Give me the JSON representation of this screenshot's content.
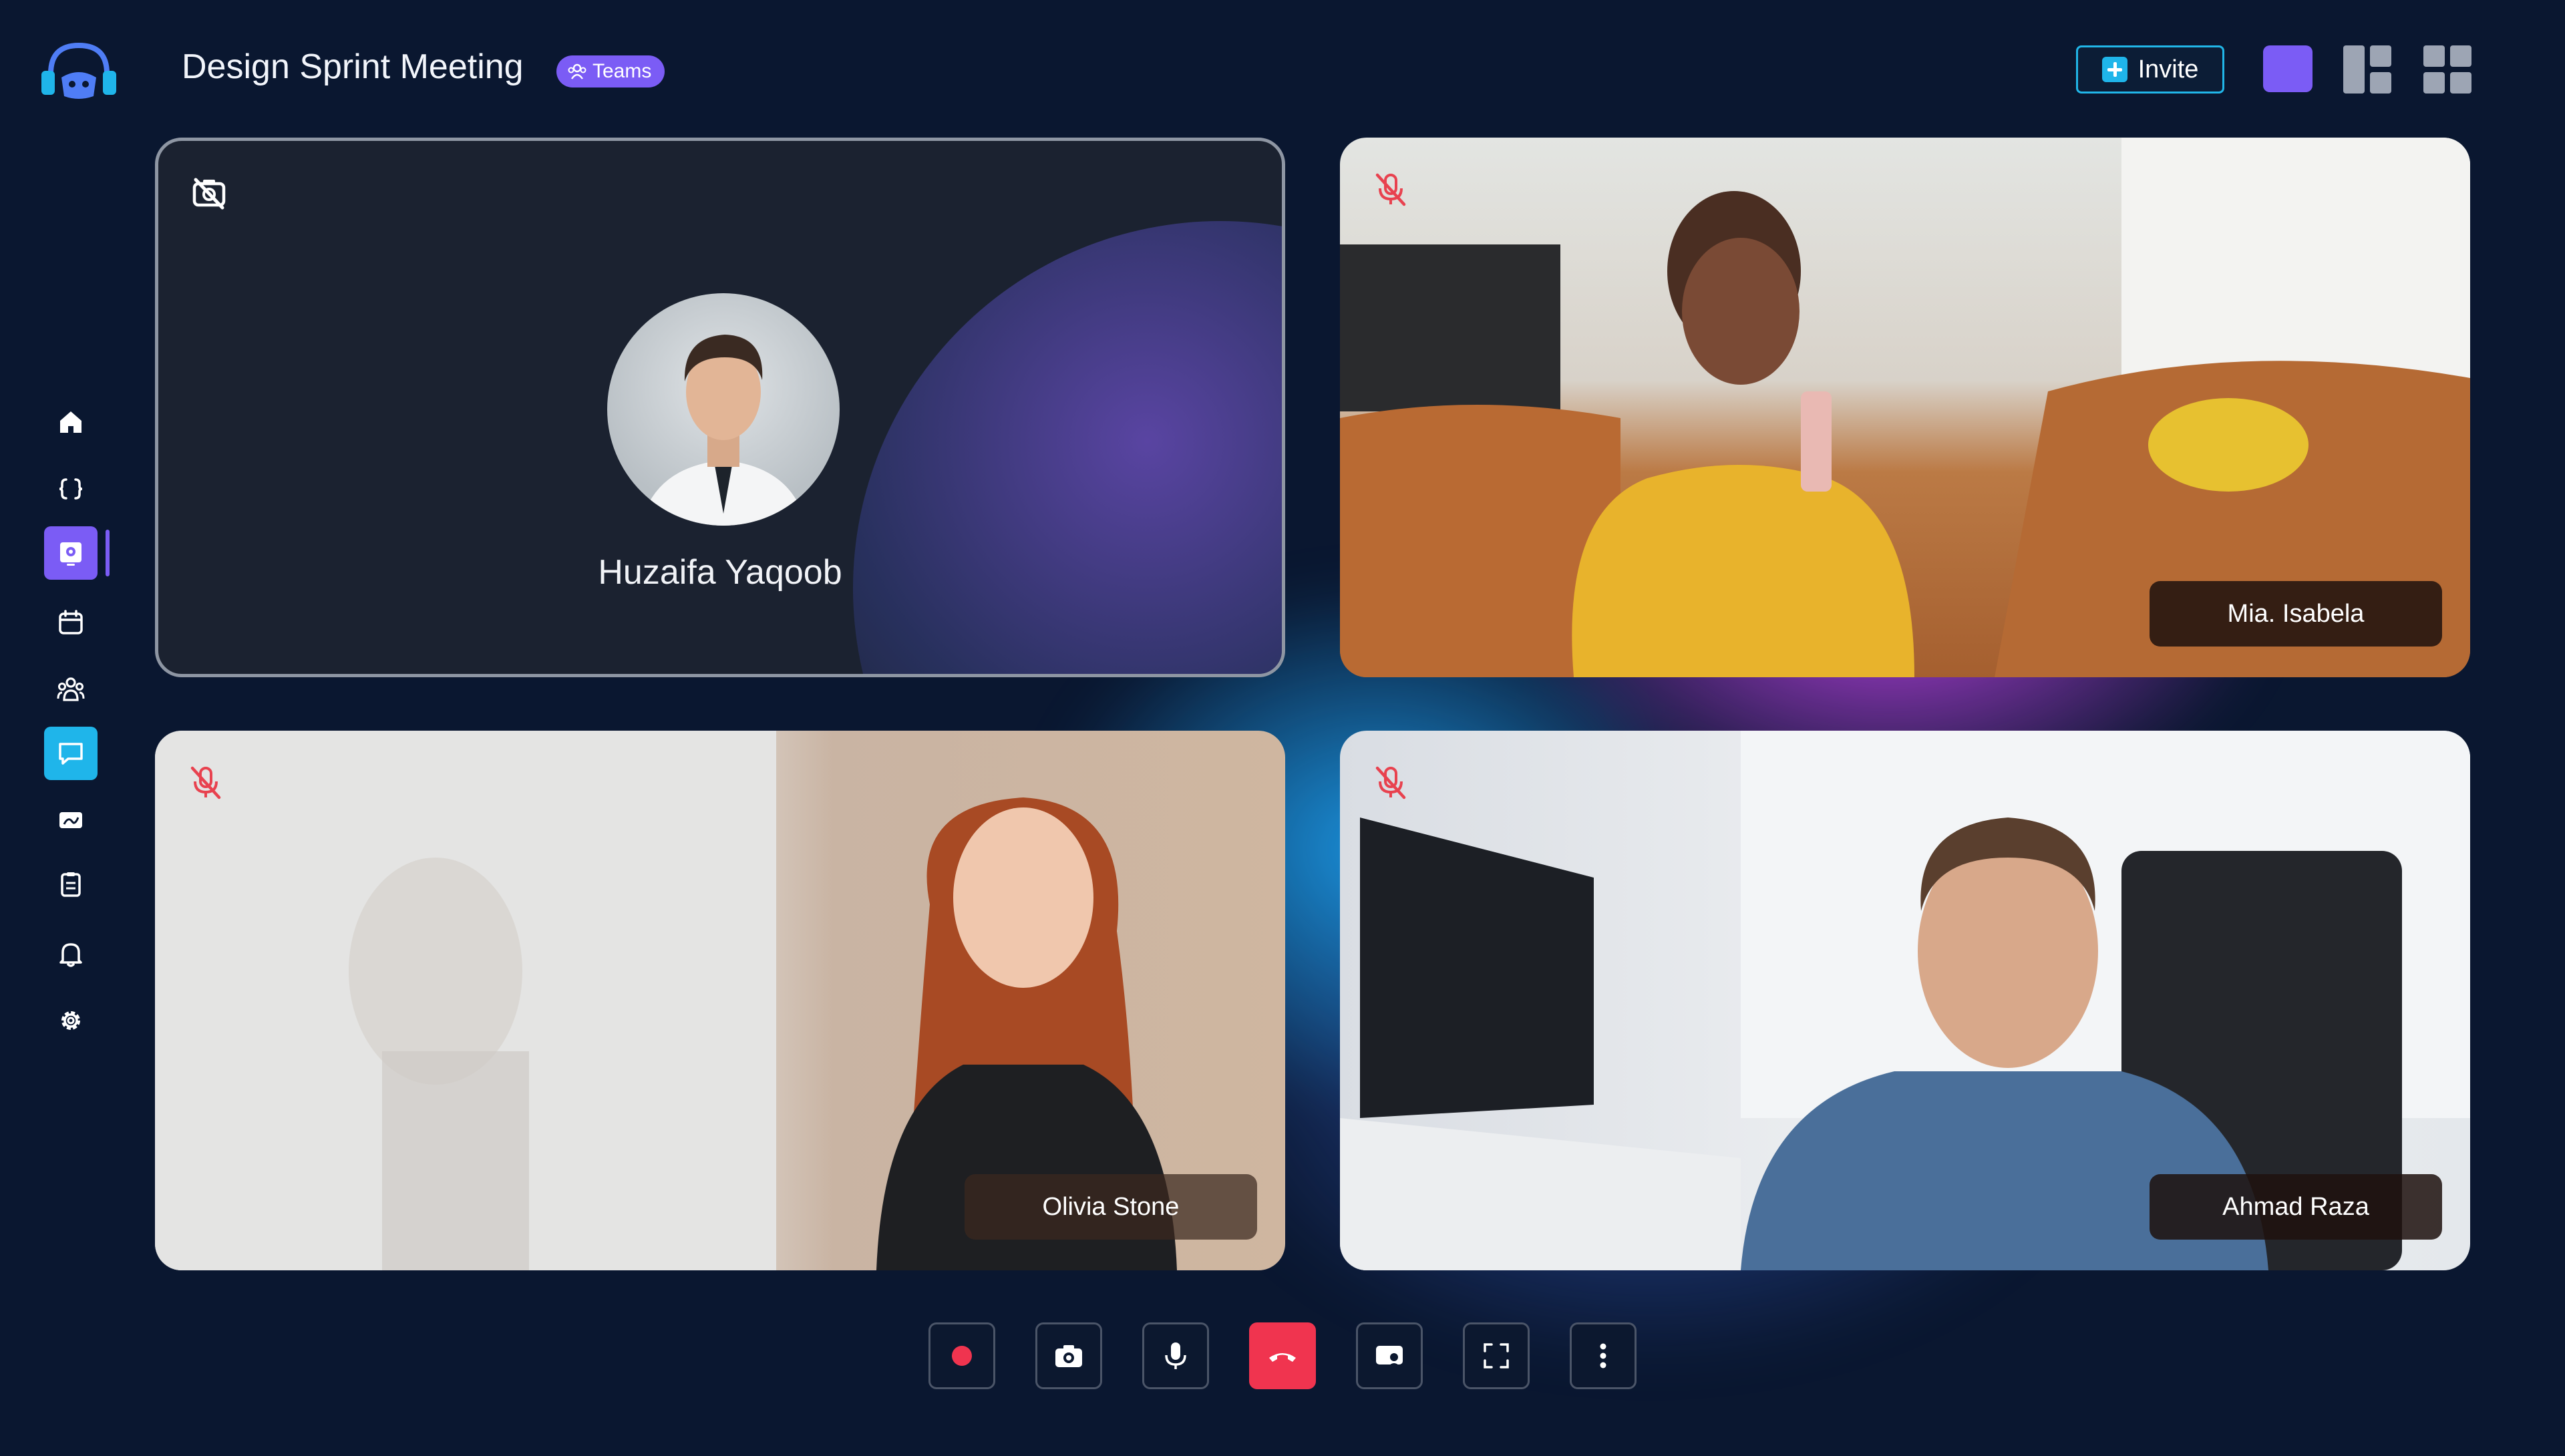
{
  "header": {
    "title": "Design Sprint Meeting",
    "badge": "Teams",
    "invite_label": "Invite"
  },
  "sidebar": {
    "items": [
      {
        "icon": "home-icon"
      },
      {
        "icon": "code-braces-icon"
      },
      {
        "icon": "video-screen-icon",
        "active": true
      },
      {
        "icon": "calendar-icon"
      },
      {
        "icon": "people-group-icon"
      },
      {
        "icon": "chat-icon",
        "highlight": true
      },
      {
        "icon": "whiteboard-icon"
      },
      {
        "icon": "clipboard-icon"
      },
      {
        "icon": "bell-icon"
      },
      {
        "icon": "settings-gear-icon"
      }
    ]
  },
  "participants": [
    {
      "name": "Huzaifa Yaqoob",
      "camera": "off"
    },
    {
      "name": "Mia. Isabela",
      "mic": "muted"
    },
    {
      "name": "Olivia Stone",
      "mic": "muted"
    },
    {
      "name": "Ahmad Raza",
      "mic": "muted"
    }
  ],
  "controls": [
    "record",
    "camera",
    "microphone",
    "end-call",
    "share-screen",
    "fullscreen",
    "more"
  ],
  "colors": {
    "background": "#0a1730",
    "accent_purple": "#7b5cf5",
    "accent_cyan": "#21b6e8",
    "end_call_red": "#f0344f",
    "muted_red": "#e8424f"
  }
}
